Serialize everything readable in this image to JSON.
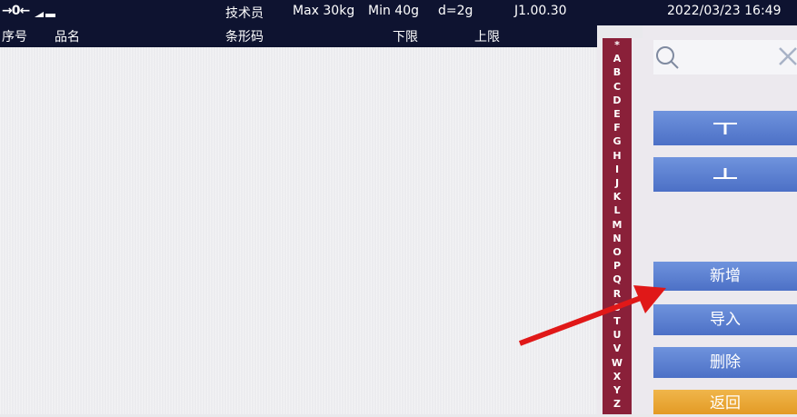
{
  "status_bar": {
    "zero_indicator": "→0←",
    "role": "技术员",
    "max": "Max 30kg",
    "min": "Min 40g",
    "d": "d=2g",
    "version": "J1.00.30",
    "datetime": "2022/03/23  16:49"
  },
  "table": {
    "columns": [
      "序号",
      "品名",
      "条形码",
      "下限",
      "上限"
    ]
  },
  "alphabet_index": [
    "*",
    "A",
    "B",
    "C",
    "D",
    "E",
    "F",
    "G",
    "H",
    "I",
    "J",
    "K",
    "L",
    "M",
    "N",
    "O",
    "P",
    "Q",
    "R",
    "S",
    "T",
    "U",
    "V",
    "W",
    "X",
    "Y",
    "Z"
  ],
  "side_panel": {
    "search_icon": "search-icon",
    "clear_icon": "close-icon",
    "buttons": {
      "up": "up-arrow-icon",
      "down": "down-arrow-icon",
      "add": "新增",
      "import": "导入",
      "delete": "删除",
      "back": "返回"
    }
  },
  "colors": {
    "bar": "#0e1330",
    "alpha": "#8a2039",
    "button_blue": "#5a7fd2",
    "button_orange": "#e8a432",
    "annotation_arrow": "#e01818"
  }
}
